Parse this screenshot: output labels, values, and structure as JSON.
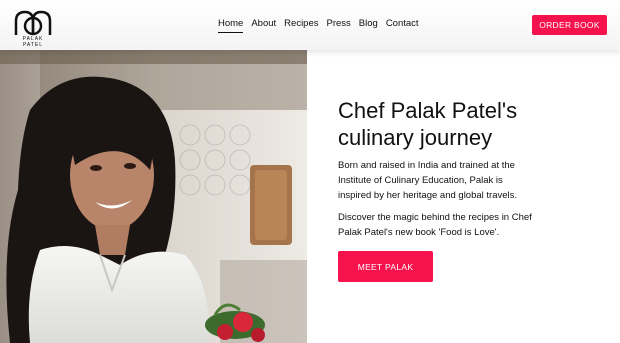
{
  "brand": {
    "logo_text": "PALAK PATEL",
    "accent": "#f5124d"
  },
  "nav": {
    "items": [
      {
        "label": "Home",
        "active": true
      },
      {
        "label": "About"
      },
      {
        "label": "Recipes"
      },
      {
        "label": "Press"
      },
      {
        "label": "Blog"
      },
      {
        "label": "Contact"
      }
    ]
  },
  "header": {
    "order_label": "ORDER BOOK"
  },
  "hero": {
    "title_line1": "Chef Palak Patel's",
    "title_line2": "culinary journey",
    "para1": "Born and raised in India and trained at the Institute of Culinary Education, Palak is inspired by her heritage and global travels.",
    "para2": "Discover the magic behind the recipes in Chef Palak Patel's new book 'Food is Love'.",
    "cta_label": "MEET PALAK"
  }
}
